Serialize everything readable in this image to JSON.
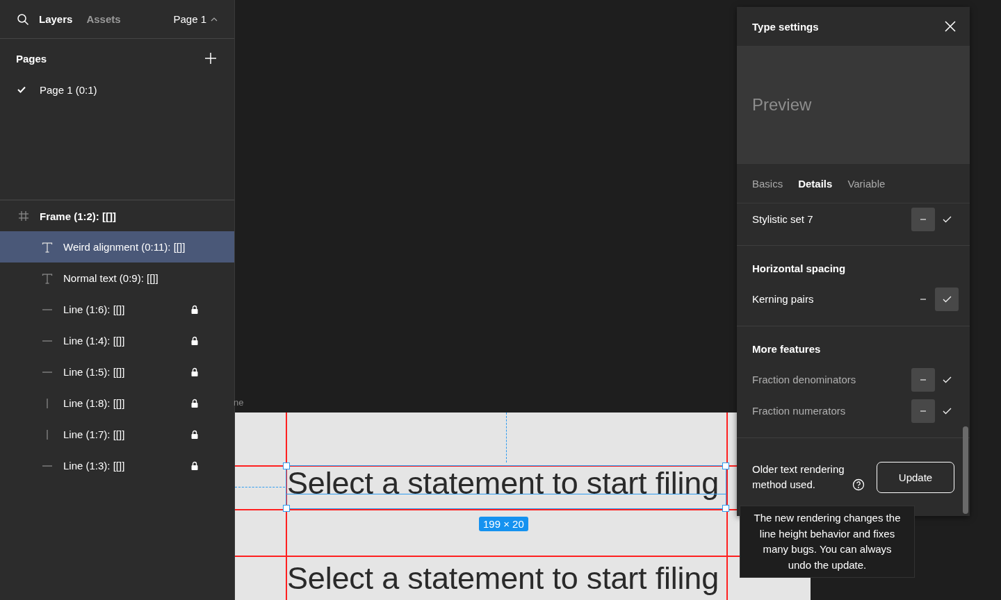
{
  "sidebar": {
    "tabs": [
      {
        "label": "Layers",
        "selected": true
      },
      {
        "label": "Assets",
        "selected": false
      }
    ],
    "page_menu": "Page 1",
    "pages": {
      "title": "Pages",
      "items": [
        {
          "label": "Page 1 (0:1)",
          "selected": true
        }
      ]
    },
    "layers": [
      {
        "kind": "frame",
        "label": "Frame (1:2): [[]]",
        "selected": false,
        "locked": false,
        "children": [
          {
            "kind": "text",
            "label": "Weird alignment (0:11): [[]]",
            "selected": true,
            "locked": false
          },
          {
            "kind": "text",
            "label": "Normal text (0:9): [[]]",
            "selected": false,
            "locked": false
          },
          {
            "kind": "hline",
            "label": "Line (1:6): [[]]",
            "selected": false,
            "locked": true
          },
          {
            "kind": "hline",
            "label": "Line (1:4): [[]]",
            "selected": false,
            "locked": true
          },
          {
            "kind": "hline",
            "label": "Line (1:5): [[]]",
            "selected": false,
            "locked": true
          },
          {
            "kind": "vline",
            "label": "Line (1:8): [[]]",
            "selected": false,
            "locked": true
          },
          {
            "kind": "vline",
            "label": "Line (1:7): [[]]",
            "selected": false,
            "locked": true
          },
          {
            "kind": "hline",
            "label": "Line (1:3): [[]]",
            "selected": false,
            "locked": true
          }
        ]
      }
    ]
  },
  "canvas": {
    "frame_label": "ne",
    "texts": [
      "Select a statement to start filing",
      "Select a statement to start filing"
    ],
    "size_badge": "199 × 20"
  },
  "type_settings": {
    "title": "Type settings",
    "preview": "Preview",
    "tabs": [
      {
        "label": "Basics",
        "selected": false
      },
      {
        "label": "Details",
        "selected": true
      },
      {
        "label": "Variable",
        "selected": false
      }
    ],
    "sections": [
      {
        "features": [
          {
            "label": "Stylistic set 7",
            "on": false,
            "disabled": false
          }
        ]
      },
      {
        "title": "Horizontal spacing",
        "features": [
          {
            "label": "Kerning pairs",
            "on": true,
            "disabled": false
          }
        ]
      },
      {
        "title": "More features",
        "features": [
          {
            "label": "Fraction denominators",
            "on": false,
            "disabled": true
          },
          {
            "label": "Fraction numerators",
            "on": false,
            "disabled": true
          }
        ]
      }
    ],
    "notice": "Older text rendering method used.",
    "button": "Update",
    "tooltip": "The new rendering changes the line height behavior and fixes many bugs. You can always undo the update."
  }
}
